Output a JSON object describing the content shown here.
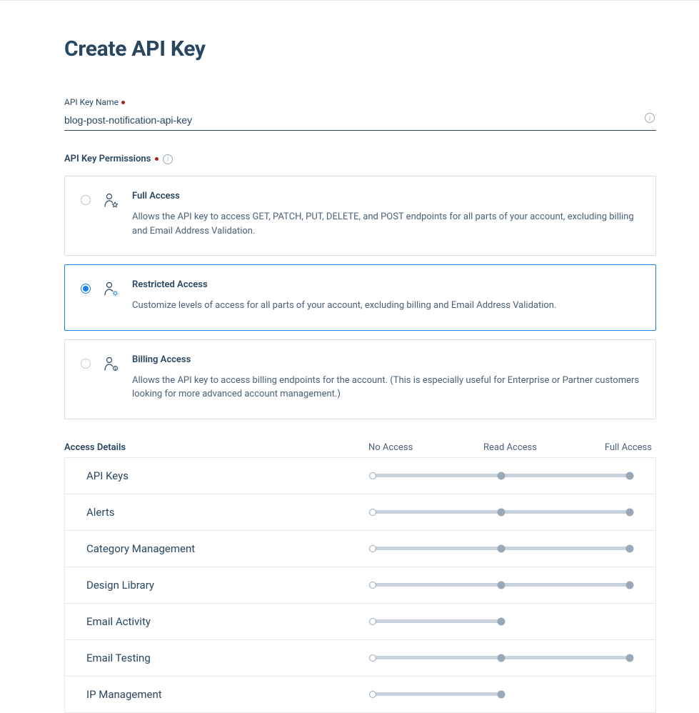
{
  "page": {
    "title": "Create API Key"
  },
  "form": {
    "name_label": "API Key Name",
    "name_value": "blog-post-notification-api-key",
    "permissions_label": "API Key Permissions"
  },
  "options": [
    {
      "id": "full",
      "title": "Full Access",
      "desc": "Allows the API key to access GET, PATCH, PUT, DELETE, and POST endpoints for all parts of your account, excluding billing and Email Address Validation.",
      "selected": false
    },
    {
      "id": "restricted",
      "title": "Restricted Access",
      "desc": "Customize levels of access for all parts of your account, excluding billing and Email Address Validation.",
      "selected": true
    },
    {
      "id": "billing",
      "title": "Billing Access",
      "desc": "Allows the API key to access billing endpoints for the account. (This is especially useful for Enterprise or Partner customers looking for more advanced account management.)",
      "selected": false
    }
  ],
  "access_table": {
    "title": "Access Details",
    "columns": [
      "No Access",
      "Read Access",
      "Full Access"
    ],
    "rows": [
      {
        "name": "API Keys",
        "max_level": 2,
        "value": 0
      },
      {
        "name": "Alerts",
        "max_level": 2,
        "value": 0
      },
      {
        "name": "Category Management",
        "max_level": 2,
        "value": 0
      },
      {
        "name": "Design Library",
        "max_level": 2,
        "value": 0
      },
      {
        "name": "Email Activity",
        "max_level": 1,
        "value": 0
      },
      {
        "name": "Email Testing",
        "max_level": 2,
        "value": 0
      },
      {
        "name": "IP Management",
        "max_level": 1,
        "value": 0
      }
    ]
  }
}
